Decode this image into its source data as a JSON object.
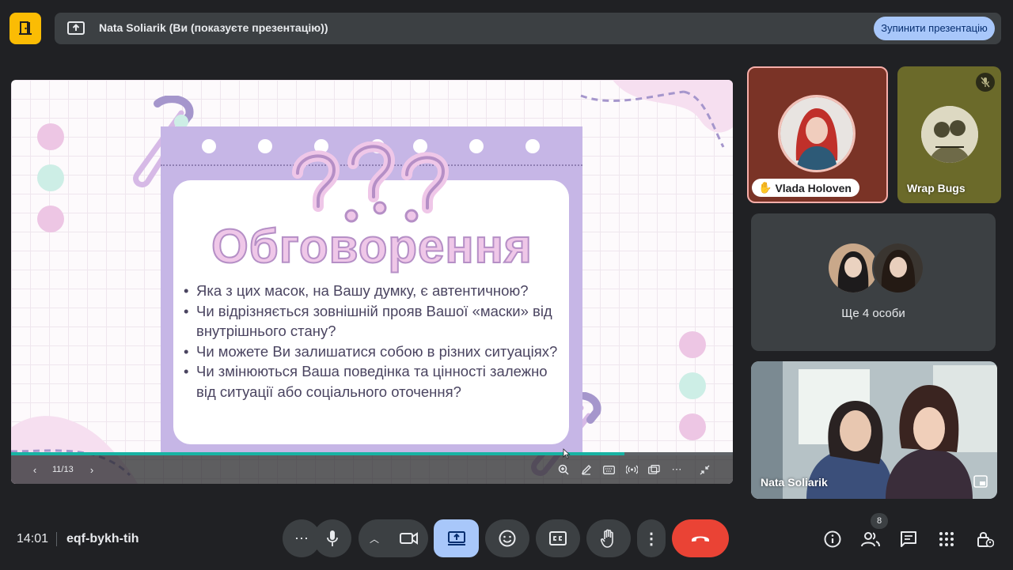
{
  "banner": {
    "presenting_text": "Nata Soliarik (Ви (показуєте презентацію))",
    "stop_button_label": "Зупинити презентацію"
  },
  "slide": {
    "title": "Обговорення",
    "bullets": [
      "Яка з цих масок, на Вашу думку, є автентичною?",
      "Чи відрізняється зовнішній прояв Вашої «маски» від внутрішнього стану?",
      "Чи можете Ви залишатися собою в різних ситуаціях?",
      "Чи змінюються Ваша поведінка та цінності залежно від ситуації або соціального оточення?"
    ],
    "page_indicator": "11/13",
    "progress": 0.85
  },
  "participants": {
    "vlada": {
      "name": "Vlada Holoven",
      "hand_raised": true
    },
    "wrap": {
      "name": "Wrap Bugs",
      "muted": true
    },
    "more": {
      "label": "Ще 4 особи"
    },
    "nata": {
      "name": "Nata Soliarik"
    }
  },
  "footer": {
    "time": "14:01",
    "meeting_code": "eqf-bykh-tih",
    "people_count": "8"
  },
  "colors": {
    "accent_blue": "#a8c7fa",
    "end_call_red": "#ea4335",
    "brand_yellow": "#fbbc04",
    "progress_teal": "#17b3a3"
  }
}
